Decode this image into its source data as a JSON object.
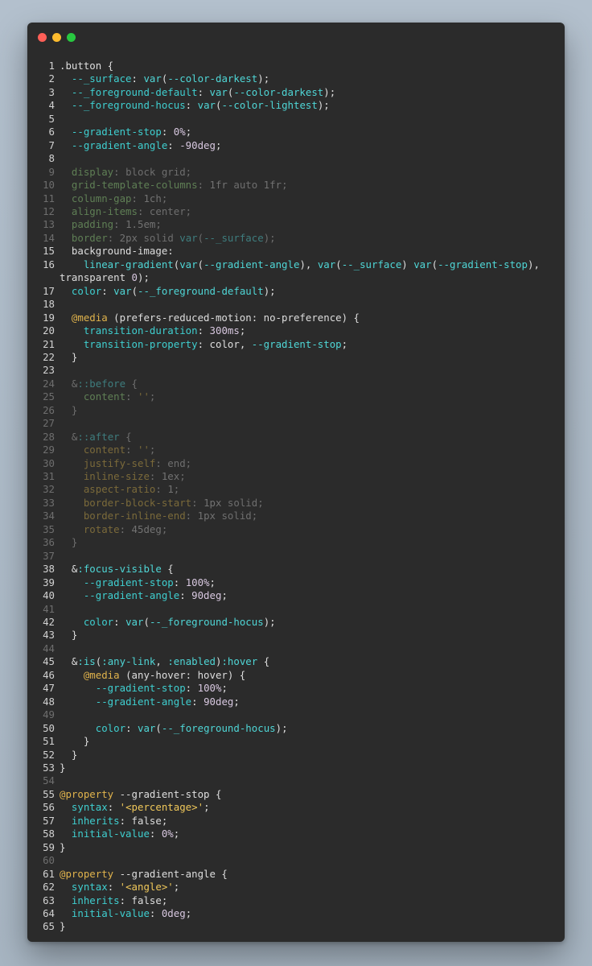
{
  "window": {
    "title": "",
    "controls": [
      "close",
      "minimize",
      "zoom"
    ]
  },
  "code": {
    "lines": [
      ".button {",
      "  --_surface: var(--color-darkest);",
      "  --_foreground-default: var(--color-darkest);",
      "  --_foreground-hocus: var(--color-lightest);",
      "",
      "  --gradient-stop: 0%;",
      "  --gradient-angle: -90deg;",
      "",
      "  display: block grid;",
      "  grid-template-columns: 1fr auto 1fr;",
      "  column-gap: 1ch;",
      "  align-items: center;",
      "  padding: 1.5em;",
      "  border: 2px solid var(--_surface);",
      "  background-image:",
      "    linear-gradient(var(--gradient-angle), var(--_surface) var(--gradient-stop), transparent 0);",
      "  color: var(--_foreground-default);",
      "",
      "  @media (prefers-reduced-motion: no-preference) {",
      "    transition-duration: 300ms;",
      "    transition-property: color, --gradient-stop;",
      "  }",
      "",
      "  &::before {",
      "    content: '';",
      "  }",
      "",
      "  &::after {",
      "    content: '';",
      "    justify-self: end;",
      "    inline-size: 1ex;",
      "    aspect-ratio: 1;",
      "    border-block-start: 1px solid;",
      "    border-inline-end: 1px solid;",
      "    rotate: 45deg;",
      "  }",
      "",
      "  &:focus-visible {",
      "    --gradient-stop: 100%;",
      "    --gradient-angle: 90deg;",
      "",
      "    color: var(--_foreground-hocus);",
      "  }",
      "",
      "  &:is(:any-link, :enabled):hover {",
      "    @media (any-hover: hover) {",
      "      --gradient-stop: 100%;",
      "      --gradient-angle: 90deg;",
      "",
      "      color: var(--_foreground-hocus);",
      "    }",
      "  }",
      "}",
      "",
      "@property --gradient-stop {",
      "  syntax: '<percentage>';",
      "  inherits: false;",
      "  initial-value: 0%;",
      "}",
      "",
      "@property --gradient-angle {",
      "  syntax: '<angle>';",
      "  inherits: false;",
      "  initial-value: 0deg;",
      "}"
    ]
  }
}
